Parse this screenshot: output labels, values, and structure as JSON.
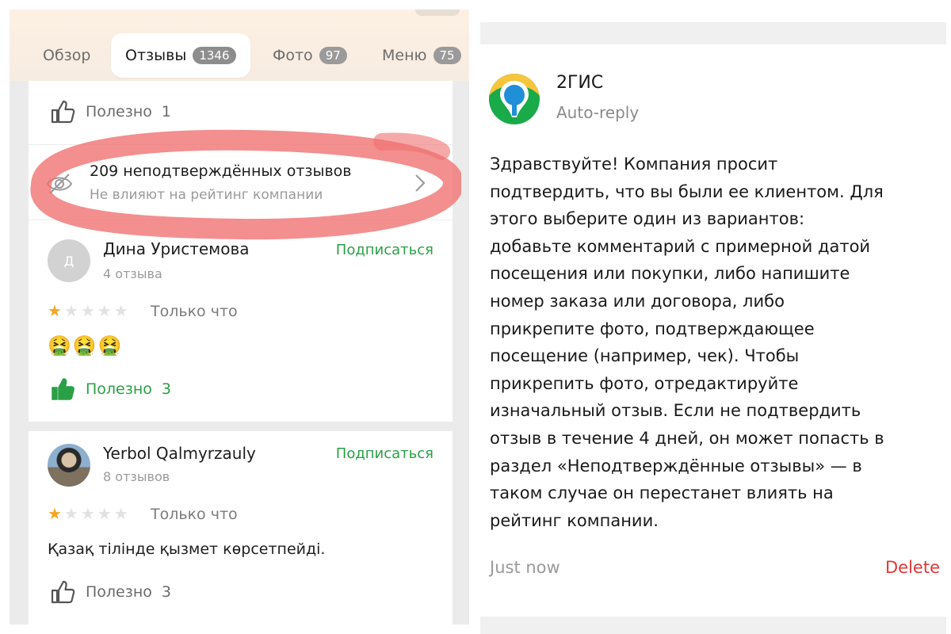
{
  "left": {
    "tabs": [
      {
        "label": "Обзор",
        "count": ""
      },
      {
        "label": "Отзывы",
        "count": "1346"
      },
      {
        "label": "Фото",
        "count": "97"
      },
      {
        "label": "Меню",
        "count": "75"
      }
    ],
    "top_helpful": {
      "label": "Полезно",
      "count": "1"
    },
    "unconfirmed": {
      "title": "209 неподтверждённых отзывов",
      "subtitle": "Не влияют на рейтинг компании"
    },
    "reviews": [
      {
        "avatar_letter": "Д",
        "name": "Дина Уристемова",
        "reviews_count": "4 отзыва",
        "subscribe": "Подписаться",
        "rating": 1,
        "time": "Только что",
        "emojis": "🤮🤮🤮",
        "text": "",
        "helpful_label": "Полезно",
        "helpful_count": "3"
      },
      {
        "avatar_letter": "",
        "name": "Yerbol Qalmyrzauly",
        "reviews_count": "8 отзывов",
        "subscribe": "Подписаться",
        "rating": 1,
        "time": "Только что",
        "emojis": "",
        "text": "Қазақ тілінде қызмет көрсетпейді.",
        "helpful_label": "Полезно",
        "helpful_count": "3"
      }
    ],
    "colors": {
      "accent_green": "#2aa046",
      "star": "#f5a623",
      "scribble": "#f07070"
    }
  },
  "right": {
    "sender": "2ГИС",
    "sender_sub": "Auto-reply",
    "message": "Здравствуйте! Компания просит\nподтвердить, что вы были ее клиентом. Для\nэтого выберите один из вариантов:\nдобавьте комментарий с примерной датой\nпосещения или покупки, либо напишите\nномер заказа или договора, либо\nприкрепите фото, подтверждающее\nпосещение (например, чек). Чтобы\nприкрепить фото, отредактируйте\nизначальный отзыв. Если не подтвердить\nотзыв в течение 4 дней, он может попасть в\nраздел «Неподтверждённые отзывы» — в\nтаком случае он перестанет влиять на\nрейтинг компании.",
    "time": "Just now",
    "delete_label": "Delete",
    "colors": {
      "delete": "#e23838",
      "logo_green": "#19aa4a",
      "logo_blue": "#1f8fd8",
      "logo_yellow": "#f6c53c"
    }
  }
}
